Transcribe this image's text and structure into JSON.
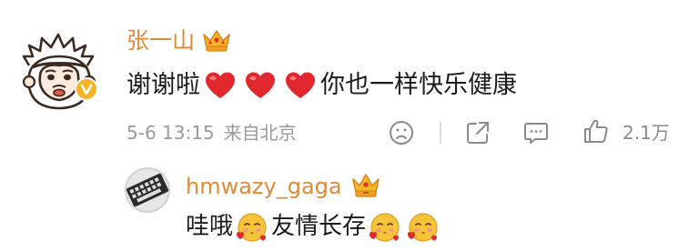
{
  "comment": {
    "username": "张一山",
    "text_before": "谢谢啦",
    "text_after": "你也一样快乐健康",
    "hearts": 3,
    "date": "5-6 13:15",
    "location": "来自北京",
    "likes": "2.1万",
    "icons": {
      "avatar": "monkey-avatar",
      "verified": "verified-v-badge-icon",
      "crown": "crown-icon",
      "heart": "red-heart-emoji-icon",
      "dislike": "frown-face-icon",
      "share": "share-icon",
      "reply": "comment-bubble-icon",
      "like": "thumbs-up-icon"
    }
  },
  "reply": {
    "username": "hmwazy_gaga",
    "text_before": "哇哦",
    "text_middle": "友情长存",
    "icons": {
      "avatar": "keyboard-avatar",
      "crown": "crown-icon",
      "emoji": "blowing-kiss-emoji-icon"
    }
  },
  "colors": {
    "username": "#e08a36",
    "text": "#1b1b1b",
    "meta": "#9a9a9a",
    "heart": "#e0282e",
    "emoji_face": "#f6c43a",
    "verified": "#f5b325"
  }
}
